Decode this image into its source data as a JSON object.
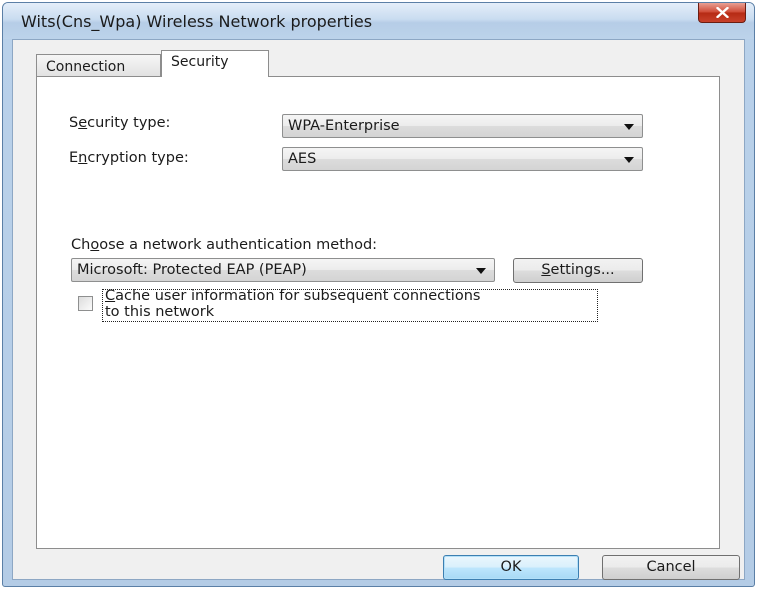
{
  "window": {
    "title": "Wits(Cns_Wpa) Wireless Network properties"
  },
  "tabs": [
    {
      "label": "Connection",
      "active": false
    },
    {
      "label": "Security",
      "active": true
    }
  ],
  "security": {
    "security_type_label_pre": "S",
    "security_type_label_u": "e",
    "security_type_label_post": "curity type:",
    "security_type_value": "WPA-Enterprise",
    "encryption_type_label_pre": "E",
    "encryption_type_label_u": "n",
    "encryption_type_label_post": "cryption type:",
    "encryption_type_value": "AES",
    "auth_method_label_pre": "Ch",
    "auth_method_label_u": "o",
    "auth_method_label_post": "ose a network authentication method:",
    "auth_method_value": "Microsoft: Protected EAP (PEAP)",
    "settings_label_u": "S",
    "settings_label_post": "ettings...",
    "cache_checkbox_label_u": "C",
    "cache_checkbox_label_line1_post": "ache user information for subsequent connections",
    "cache_checkbox_label_line2": "to this network",
    "cache_checked": false
  },
  "footer": {
    "ok_label": "OK",
    "cancel_label": "Cancel"
  },
  "colors": {
    "title_bar": "#c9dcf0",
    "close_button": "#cf4a36",
    "default_button": "#bee6fd"
  }
}
